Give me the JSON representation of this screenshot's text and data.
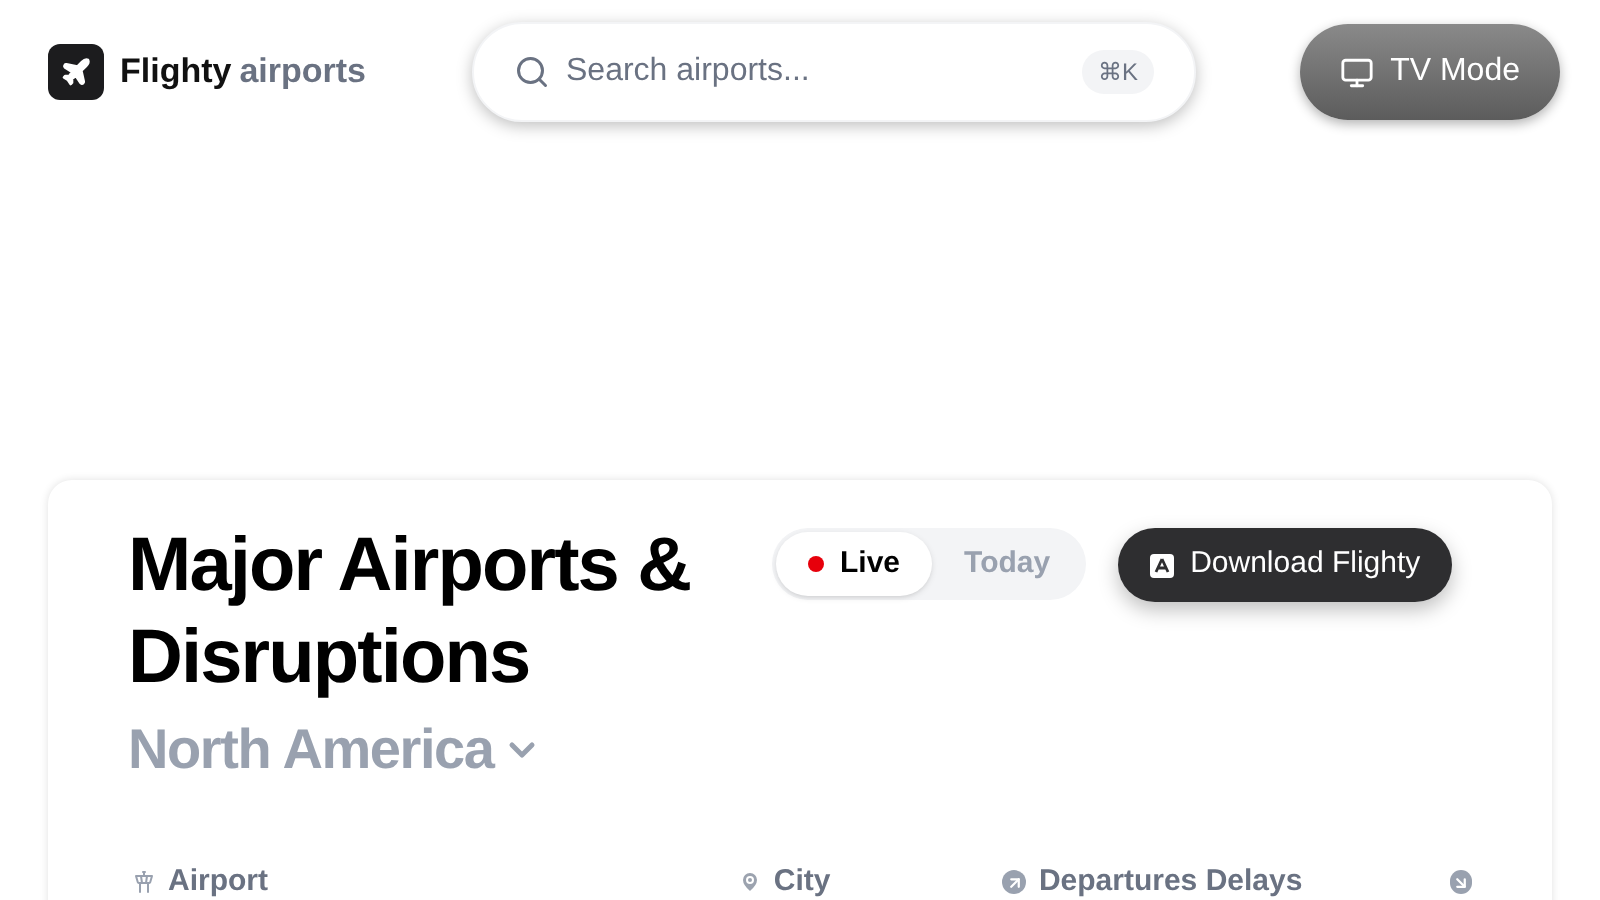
{
  "brand": {
    "name": "Flighty",
    "suffix": "airports"
  },
  "search": {
    "placeholder": "Search airports...",
    "shortcut": "⌘K"
  },
  "tv_button": {
    "label": "TV Mode"
  },
  "card": {
    "title": "Major Airports & Disruptions",
    "region": "North America",
    "tabs": [
      {
        "label": "Live",
        "selected": true,
        "kind": "live"
      },
      {
        "label": "Today",
        "selected": false,
        "kind": "plain"
      }
    ],
    "download_button": {
      "label": "Download Flighty"
    },
    "columns": [
      {
        "label": "Airport",
        "kind": "airport"
      },
      {
        "label": "City",
        "kind": "city"
      },
      {
        "label": "Departures Delays",
        "kind": "departures"
      }
    ]
  }
}
